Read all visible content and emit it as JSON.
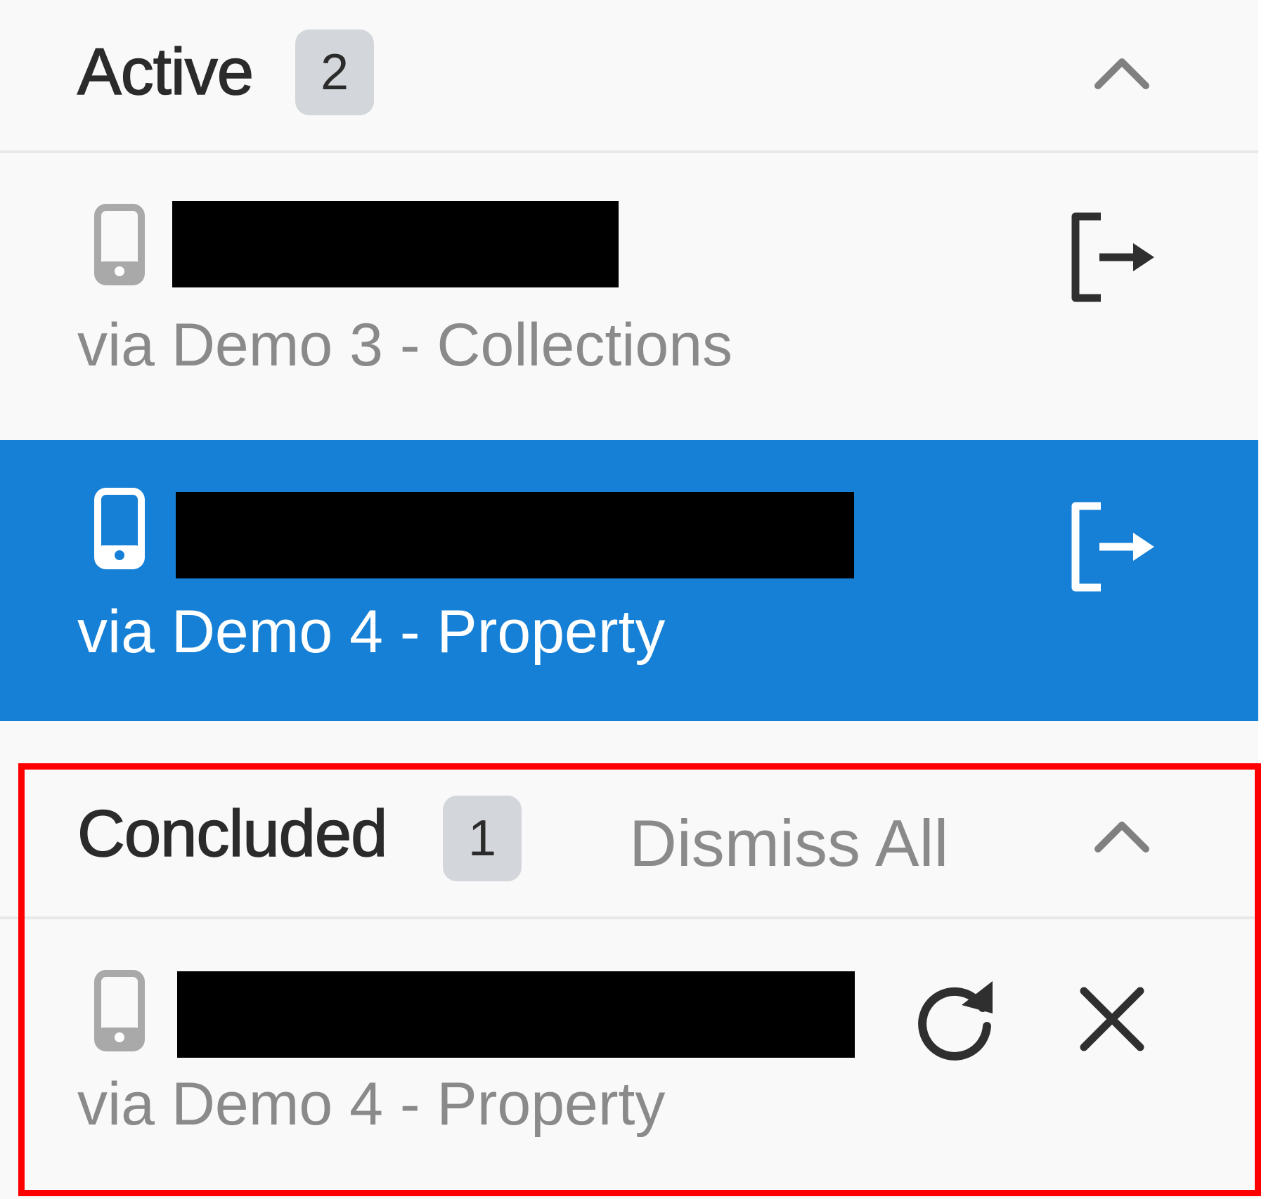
{
  "active": {
    "title": "Active",
    "count": "2",
    "items": [
      {
        "subtitle": "via Demo 3 - Collections",
        "selected": false
      },
      {
        "subtitle": "via Demo 4 - Property",
        "selected": true
      }
    ]
  },
  "concluded": {
    "title": "Concluded",
    "count": "1",
    "dismiss_all_label": "Dismiss All",
    "items": [
      {
        "subtitle": "via Demo 4 - Property"
      }
    ]
  },
  "colors": {
    "accent": "#1580d6",
    "highlight": "#ff0000",
    "badge_bg": "#d3d6da"
  },
  "icons": [
    "chevron-up-icon",
    "phone-icon",
    "logout-icon",
    "refresh-icon",
    "close-icon"
  ]
}
